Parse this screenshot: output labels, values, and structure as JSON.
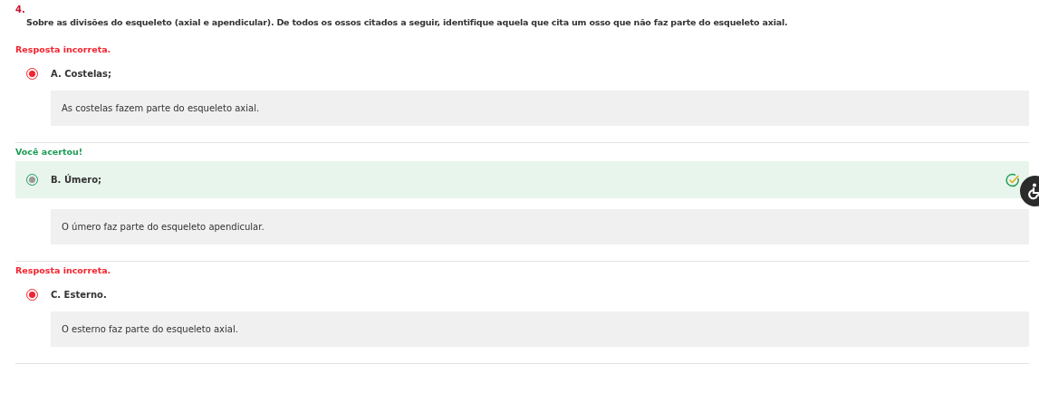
{
  "question": {
    "number": "4.",
    "text": "Sobre as divisões do esqueleto (axial e apendicular). De todos os ossos citados a seguir, identifique aquela que cita um osso que não faz parte do esqueleto axial."
  },
  "options": [
    {
      "kind": "incorrect",
      "status": "Resposta incorreta.",
      "label": "A. Costelas;",
      "selected": true,
      "feedback": "As costelas fazem parte do esqueleto axial."
    },
    {
      "kind": "correct",
      "status": "Você acertou!",
      "label": "B. Úmero;",
      "selected": true,
      "feedback": "O úmero faz parte do esqueleto apendicular."
    },
    {
      "kind": "incorrect",
      "status": "Resposta incorreta.",
      "label": "C. Esterno.",
      "selected": true,
      "feedback": "O esterno faz parte do esqueleto axial."
    }
  ]
}
